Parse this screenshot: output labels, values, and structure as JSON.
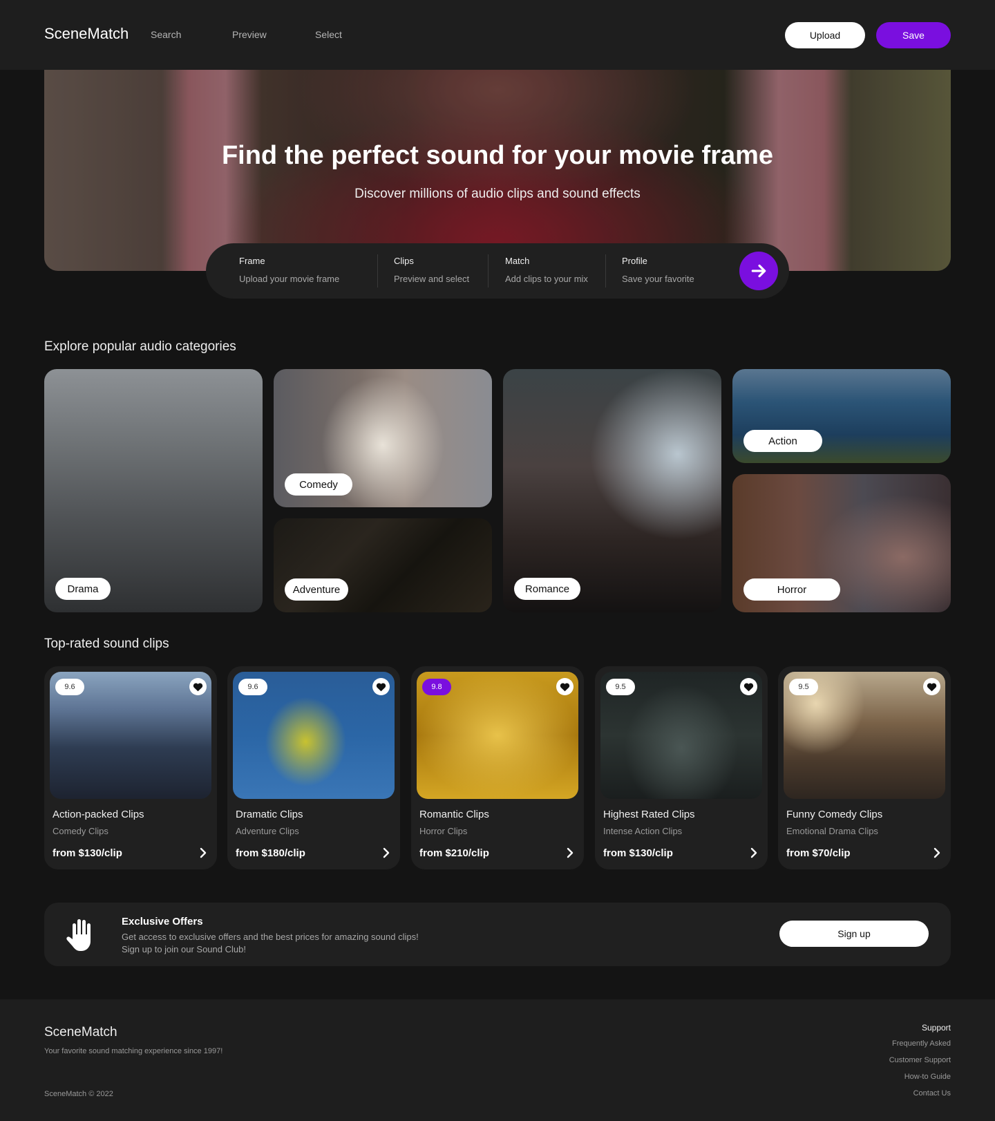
{
  "header": {
    "logo": "SceneMatch",
    "nav": [
      "Search",
      "Preview",
      "Select"
    ],
    "upload_label": "Upload",
    "save_label": "Save"
  },
  "hero": {
    "title": "Find the perfect sound for your movie frame",
    "subtitle": "Discover millions of audio clips and sound effects",
    "steps": [
      {
        "title": "Frame",
        "desc": "Upload your movie frame"
      },
      {
        "title": "Clips",
        "desc": "Preview and select"
      },
      {
        "title": "Match",
        "desc": "Add clips to your mix"
      },
      {
        "title": "Profile",
        "desc": "Save your favorite"
      }
    ]
  },
  "categories": {
    "title": "Explore popular audio categories",
    "items": [
      "Drama",
      "Comedy",
      "Adventure",
      "Romance",
      "Action",
      "Horror"
    ]
  },
  "clips": {
    "title": "Top-rated sound clips",
    "items": [
      {
        "score": "9.6",
        "title": "Action-packed Clips",
        "sub": "Comedy Clips",
        "price": "from $130/clip"
      },
      {
        "score": "9.6",
        "title": "Dramatic Clips",
        "sub": "Adventure Clips",
        "price": "from $180/clip"
      },
      {
        "score": "9.8",
        "title": "Romantic Clips",
        "sub": "Horror Clips",
        "price": "from $210/clip"
      },
      {
        "score": "9.5",
        "title": "Highest Rated Clips",
        "sub": "Intense Action Clips",
        "price": "from $130/clip"
      },
      {
        "score": "9.5",
        "title": "Funny Comedy Clips",
        "sub": "Emotional Drama Clips",
        "price": "from $70/clip"
      }
    ]
  },
  "offer": {
    "title": "Exclusive Offers",
    "line1": "Get access to exclusive offers and the best prices for amazing sound clips!",
    "line2": "Sign up to join our Sound Club!",
    "button": "Sign up"
  },
  "footer": {
    "logo": "SceneMatch",
    "tagline": "Your favorite sound matching experience since 1997!",
    "copyright": "SceneMatch © 2022",
    "links_heading": "Support",
    "links": [
      "Frequently Asked",
      "Customer Support",
      "How-to Guide",
      "Contact Us"
    ]
  },
  "colors": {
    "accent": "#7a0fdf",
    "background": "#141414",
    "surface": "#202020"
  }
}
